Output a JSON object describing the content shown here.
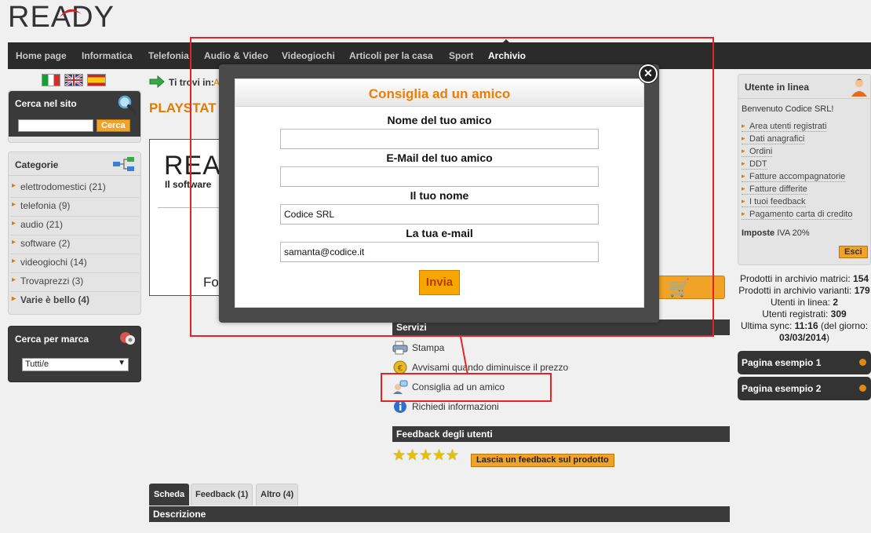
{
  "header": {
    "logo_text": "READY"
  },
  "nav": {
    "items": [
      "Home page",
      "Informatica",
      "Telefonia",
      "Audio & Video",
      "Videogiochi",
      "Articoli per la casa",
      "Sport",
      "Archivio"
    ]
  },
  "flags": {
    "italian": "flag-it-icon",
    "english": "flag-en-icon",
    "spanish": "flag-es-icon"
  },
  "sidebar_left": {
    "search": {
      "title": "Cerca nel sito",
      "input_value": "",
      "button": "Cerca"
    },
    "categories": {
      "title": "Categorie",
      "items": [
        "elettrodomestici (21)",
        "telefonia (9)",
        "audio (21)",
        "software (2)",
        "videogiochi (14)",
        "Trovaprezzi (3)",
        "Varie è bello (4)"
      ]
    },
    "brand": {
      "title": "Cerca per marca",
      "selected": "Tutti/e"
    }
  },
  "content": {
    "breadcrumb_label": "Ti trovi in:",
    "breadcrumb_link": "A",
    "product_title": "PLAYSTAT",
    "image_logo": "REA",
    "image_sub": "Il software",
    "image_fo": "Fo",
    "services_title": "Servizi",
    "services": [
      "Stampa",
      "Avvisami quando diminuisce il prezzo",
      "Consiglia ad un amico",
      "Richiedi informazioni"
    ],
    "feedback_title": "Feedback degli utenti",
    "rating_stars": 5,
    "feedback_button": "Lascia un feedback sul prodotto",
    "tabs": [
      "Scheda",
      "Feedback (1)",
      "Altro (4)"
    ],
    "description_title": "Descrizione"
  },
  "sidebar_right": {
    "user": {
      "title": "Utente in linea",
      "welcome": "Benvenuto Codice SRL!",
      "links": [
        "Area utenti registrati",
        "Dati anagrafici",
        "Ordini",
        "DDT",
        "Fatture accompagnatorie",
        "Fatture differite",
        "I tuoi feedback",
        "Pagamento carta di credito"
      ],
      "vat_label": "Imposte",
      "vat_value": "IVA 20%",
      "exit": "Esci"
    },
    "stats": {
      "matrici_label": "Prodotti in archivio matrici:",
      "matrici_value": "154",
      "varianti_label": "Prodotti in archivio varianti:",
      "varianti_value": "179",
      "online_label": "Utenti in linea:",
      "online_value": "2",
      "registered_label": "Utenti registrati:",
      "registered_value": "309",
      "sync_label": "Ultima sync:",
      "sync_time": "11:16",
      "sync_mid": "(del giorno:",
      "sync_date": "03/03/2014",
      "sync_end": ")"
    },
    "pages": [
      "Pagina esempio 1",
      "Pagina esempio 2"
    ]
  },
  "modal": {
    "title": "Consiglia ad un amico",
    "fields": [
      {
        "label": "Nome del tuo amico",
        "value": ""
      },
      {
        "label": "E-Mail del tuo amico",
        "value": ""
      },
      {
        "label": "Il tuo nome",
        "value": "Codice SRL"
      },
      {
        "label": "La tua e-mail",
        "value": "samanta@codice.it"
      }
    ],
    "submit": "Invia",
    "close": "✕"
  },
  "colors": {
    "accent": "#f07d00",
    "button": "#f7a600",
    "dark_bar": "#2b2b2b",
    "annotation": "#e42424"
  }
}
